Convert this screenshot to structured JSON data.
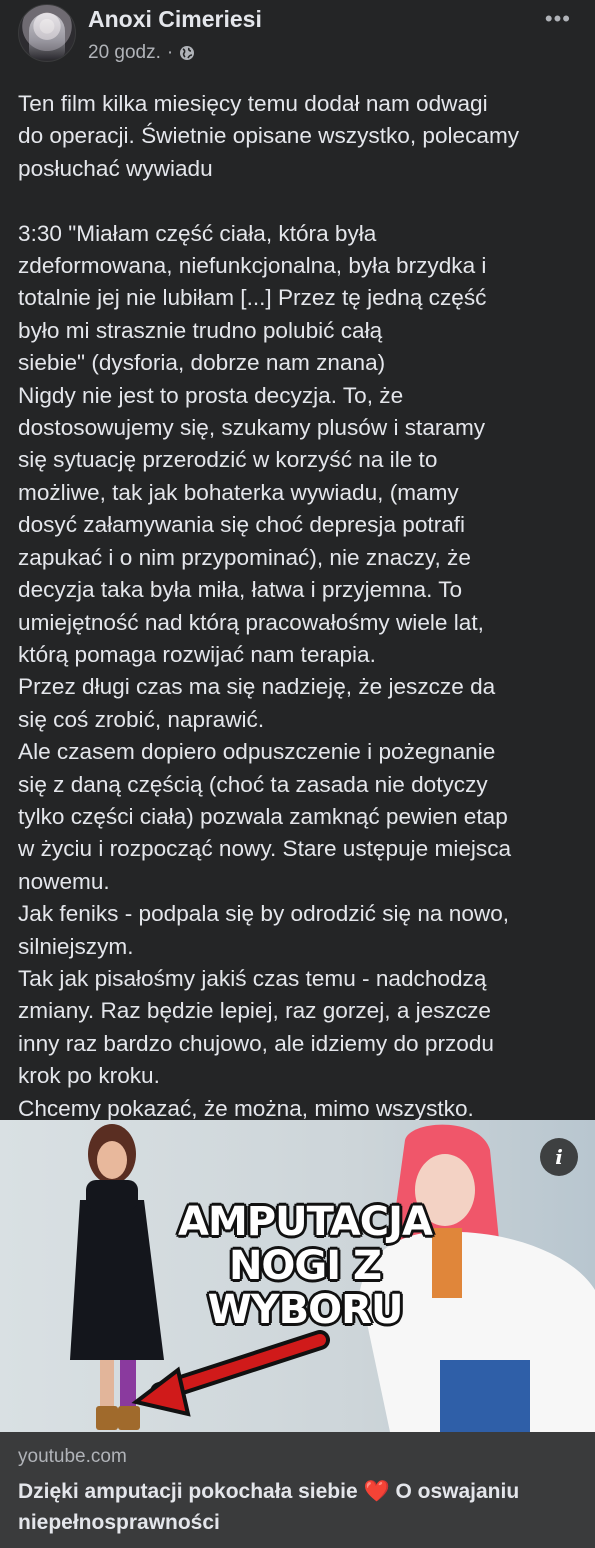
{
  "post": {
    "author": "Anoxi Cimeriesi",
    "time": "20 godz.",
    "separator": "·",
    "privacy_icon": "globe-icon",
    "more_icon": "more-options-icon",
    "more_label": "•••",
    "text": "Ten film kilka miesięcy temu dodał nam odwagi\ndo operacji. Świetnie opisane wszystko, polecamy\nposłuchać wywiadu\n\n3:30  \"Miałam część ciała, która była\nzdeformowana, niefunkcjonalna, była brzydka i\ntotalnie jej nie lubiłam [...] Przez tę jedną część\nbyło mi strasznie trudno polubić całą\nsiebie\" (dysforia, dobrze nam znana)\nNigdy nie jest to prosta decyzja. To, że\ndostosowujemy się, szukamy plusów i staramy\nsię sytuację przerodzić w korzyść na ile to\nmożliwe, tak jak bohaterka wywiadu, (mamy\ndosyć załamywania się choć depresja potrafi\nzapukać i o nim przypominać), nie znaczy, że\ndecyzja taka była miła, łatwa i przyjemna. To\numiejętność nad którą pracowałośmy wiele lat,\nktórą pomaga rozwijać nam terapia.\nPrzez długi czas ma się nadzieję, że jeszcze da\nsię coś zrobić, naprawić.\nAle czasem dopiero odpuszczenie i pożegnanie\nsię z daną częścią (choć ta zasada nie dotyczy\ntylko części ciała) pozwala zamknąć pewien etap\nw życiu i rozpocząć nowy. Stare ustępuje miejsca\nnowemu.\nJak feniks - podpala się by odrodzić się na nowo,\nsilniejszym.\nTak jak pisałośmy jakiś czas temu - nadchodzą\nzmiany. Raz będzie lepiej, raz gorzej, a jeszcze\ninny raz bardzo chujowo, ale idziemy do przodu\nkrok po kroku.\nChcemy pokazać, że można, mimo wszystko."
  },
  "link_preview": {
    "thumbnail_text": "AMPUTACJA\nNOGI Z\nWYBORU",
    "info_label": "i",
    "domain": "youtube.com",
    "title_before": "Dzięki amputacji pokochała siebie ",
    "heart": "❤️",
    "title_after": " O oswajaniu niepełnosprawności"
  },
  "colors": {
    "background": "#242526",
    "link_box": "#3a3b3c",
    "text_primary": "#e4e6eb",
    "text_secondary": "#b0b3b8"
  }
}
